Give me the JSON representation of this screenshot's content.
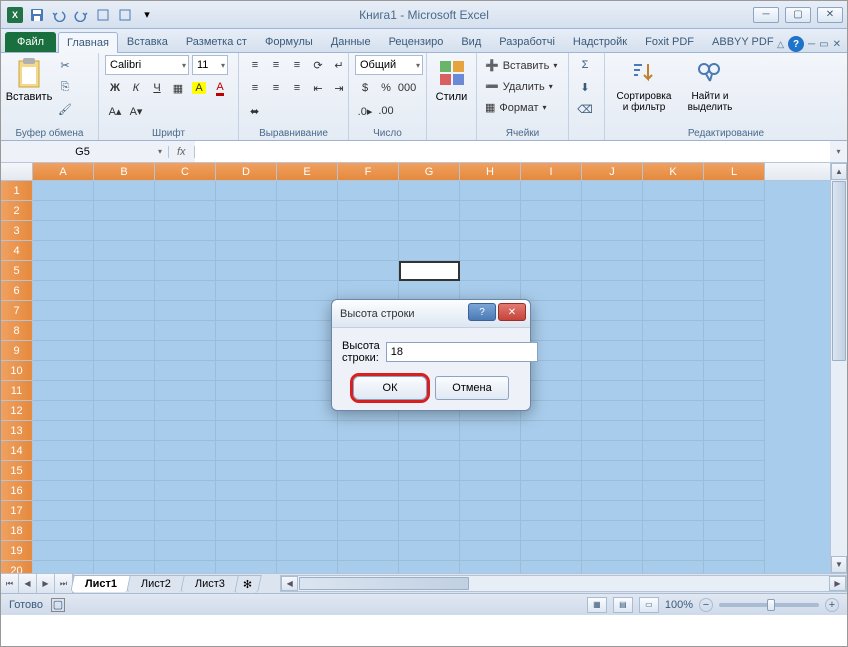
{
  "title": "Книга1 - Microsoft Excel",
  "tabs": {
    "file": "Файл",
    "home": "Главная",
    "insert": "Вставка",
    "layout": "Разметка ст",
    "formulas": "Формулы",
    "data": "Данные",
    "review": "Рецензиро",
    "view": "Вид",
    "developer": "Разработчі",
    "addins": "Надстройк",
    "foxit": "Foxit PDF",
    "abbyy": "ABBYY PDF"
  },
  "groups": {
    "clipboard": "Буфер обмена",
    "font": "Шрифт",
    "align": "Выравнивание",
    "number": "Число",
    "styles": "Стили",
    "cells": "Ячейки",
    "editing": "Редактирование"
  },
  "clipboard": {
    "paste": "Вставить"
  },
  "font": {
    "name": "Calibri",
    "size": "11",
    "bold": "Ж",
    "italic": "К",
    "underline": "Ч"
  },
  "number": {
    "format": "Общий"
  },
  "cells": {
    "insert": "Вставить",
    "delete": "Удалить",
    "format": "Формат"
  },
  "editing": {
    "sort": "Сортировка и фильтр",
    "find": "Найти и выделить"
  },
  "name_box": "G5",
  "columns": [
    "A",
    "B",
    "C",
    "D",
    "E",
    "F",
    "G",
    "H",
    "I",
    "J",
    "K",
    "L"
  ],
  "rows_count": 21,
  "active": {
    "row": 5,
    "col": "G"
  },
  "sheets": {
    "s1": "Лист1",
    "s2": "Лист2",
    "s3": "Лист3"
  },
  "status": {
    "ready": "Готово",
    "zoom": "100%"
  },
  "dialog": {
    "title": "Высота строки",
    "label": "Высота строки:",
    "value": "18",
    "ok": "ОК",
    "cancel": "Отмена"
  }
}
